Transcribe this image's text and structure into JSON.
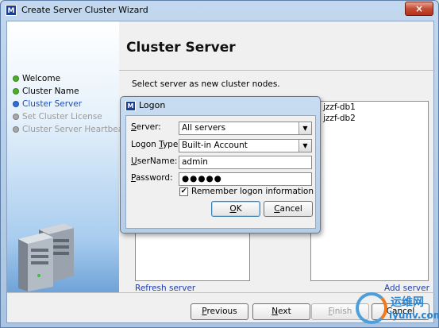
{
  "window": {
    "title": "Create Server Cluster Wizard",
    "close_glyph": "×"
  },
  "app_icon_glyph": "M",
  "steps": [
    {
      "label": "Welcome",
      "status": "done",
      "color": "#4caf2a"
    },
    {
      "label": "Cluster Name",
      "status": "done",
      "color": "#4caf2a"
    },
    {
      "label": "Cluster Server",
      "status": "current",
      "color": "#2d6fd6"
    },
    {
      "label": "Set Cluster License",
      "status": "pending",
      "color": "#a8a8a8"
    },
    {
      "label": "Cluster Server Heartbeat",
      "status": "pending",
      "color": "#a8a8a8"
    }
  ],
  "page": {
    "title": "Cluster Server",
    "instruction": "Select server as new cluster nodes."
  },
  "available_servers": [],
  "cluster_nodes": [
    "jzzf-db1",
    "jzzf-db2"
  ],
  "links": {
    "refresh": "Refresh server",
    "add": "Add server"
  },
  "buttons": {
    "previous": {
      "label": "Previous",
      "mnemonic": "P",
      "rest": "revious"
    },
    "next": {
      "label": "Next",
      "mnemonic": "N",
      "rest": "ext"
    },
    "finish": {
      "label": "Finish",
      "mnemonic": "F",
      "rest": "inish"
    },
    "cancel": {
      "label": "Cancel"
    }
  },
  "dialog": {
    "title": "Logon",
    "server": {
      "mnemonic": "S",
      "rest": "erver:",
      "value": "All servers"
    },
    "logon_type": {
      "pre": "Logon ",
      "mnemonic": "T",
      "rest": "ype:",
      "value": "Built-in Account"
    },
    "username": {
      "mnemonic": "U",
      "rest": "serName:",
      "value": "admin"
    },
    "password": {
      "mnemonic": "P",
      "rest": "assword:",
      "value": "●●●●●"
    },
    "remember": {
      "label": "Remember logon information",
      "checked": true
    },
    "ok": {
      "mnemonic": "O",
      "rest": "K"
    },
    "cancel": {
      "mnemonic": "C",
      "rest": "ancel"
    }
  },
  "watermark": {
    "cn": "运维网",
    "en": "iyunv.com"
  }
}
